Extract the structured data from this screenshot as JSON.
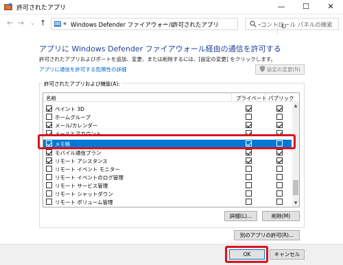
{
  "window": {
    "title": "許可されたアプリ"
  },
  "address": {
    "prefix": "«",
    "crumbs": [
      "Windows Defender ファイアウォール",
      "許可されたアプリ"
    ]
  },
  "search": {
    "placeholder": "コントロール パネルの検索"
  },
  "main": {
    "heading": "アプリに Windows Defender ファイアウォール経由の通信を許可する",
    "description": "許可されたアプリおよびポートを追加、変更、または削除するには、[設定の変更] をクリックします。",
    "risk_link": "アプリに通信を許可する危険性の詳細",
    "change_settings_label": "設定の変更(N)"
  },
  "group": {
    "label": "許可されたアプリおよび機能(A):"
  },
  "list": {
    "headers": {
      "name": "名前",
      "private": "プライベート",
      "public": "パブリック"
    },
    "rows": [
      {
        "name": "ペイント 3D",
        "enabled": true,
        "private": true,
        "public": true
      },
      {
        "name": "ホームグループ",
        "enabled": false,
        "private": false,
        "public": false
      },
      {
        "name": "メール/カレンダー",
        "enabled": true,
        "private": true,
        "public": true
      },
      {
        "name": "メールとアカウント",
        "enabled": true,
        "private": true,
        "public": true
      },
      {
        "name": "メモ帳",
        "enabled": true,
        "private": true,
        "public": false,
        "selected": true
      },
      {
        "name": "モバイル通信プラン",
        "enabled": true,
        "private": true,
        "public": true
      },
      {
        "name": "リモート アシスタンス",
        "enabled": true,
        "private": true,
        "public": true
      },
      {
        "name": "リモート イベント モニター",
        "enabled": false,
        "private": false,
        "public": false
      },
      {
        "name": "リモート イベントのログ管理",
        "enabled": false,
        "private": false,
        "public": false
      },
      {
        "name": "リモート サービス管理",
        "enabled": false,
        "private": false,
        "public": false
      },
      {
        "name": "リモート シャットダウン",
        "enabled": false,
        "private": false,
        "public": false
      },
      {
        "name": "リモート ボリューム管理",
        "enabled": false,
        "private": false,
        "public": false
      }
    ]
  },
  "buttons": {
    "details": "詳細(L)...",
    "remove": "削除(M)",
    "allow_another": "別のアプリの許可(R)...",
    "ok": "OK",
    "cancel": "キャンセル"
  },
  "window_controls": {
    "minimize": "—",
    "maximize": "☐",
    "close": "✕"
  },
  "nav": {
    "back": "←",
    "forward": "→",
    "up": "↑",
    "refresh": "↻",
    "dropdown": "⌄"
  },
  "scrollbar": {
    "up": "▲",
    "down": "▼"
  },
  "colors": {
    "selection": "#0078d7",
    "highlight": "#d9121e",
    "heading": "#1f3e99",
    "link": "#0066cc"
  }
}
